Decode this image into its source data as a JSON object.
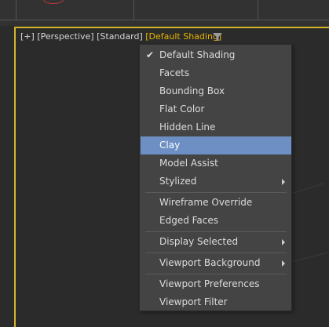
{
  "viewport_label": {
    "plus": "[+]",
    "view": "[Perspective]",
    "shading_mode": "[Standard]",
    "shading_menu": "[Default Shading]"
  },
  "shading_menu": {
    "items": [
      {
        "label": "Default Shading",
        "checked": true
      },
      {
        "label": "Facets"
      },
      {
        "label": "Bounding Box"
      },
      {
        "label": "Flat Color"
      },
      {
        "label": "Hidden Line"
      },
      {
        "label": "Clay",
        "highlighted": true
      },
      {
        "label": "Model Assist"
      },
      {
        "label": "Stylized",
        "submenu": true
      },
      {
        "label": "Wireframe Override"
      },
      {
        "label": "Edged Faces"
      },
      {
        "label": "Display Selected",
        "submenu": true
      },
      {
        "label": "Viewport Background",
        "submenu": true
      },
      {
        "label": "Viewport Preferences"
      },
      {
        "label": "Viewport Filter"
      }
    ],
    "check_glyph": "✔"
  },
  "colors": {
    "active_viewport_border": "#d7b52a",
    "highlight": "#6d8fc4",
    "menu_bg": "#444444"
  }
}
